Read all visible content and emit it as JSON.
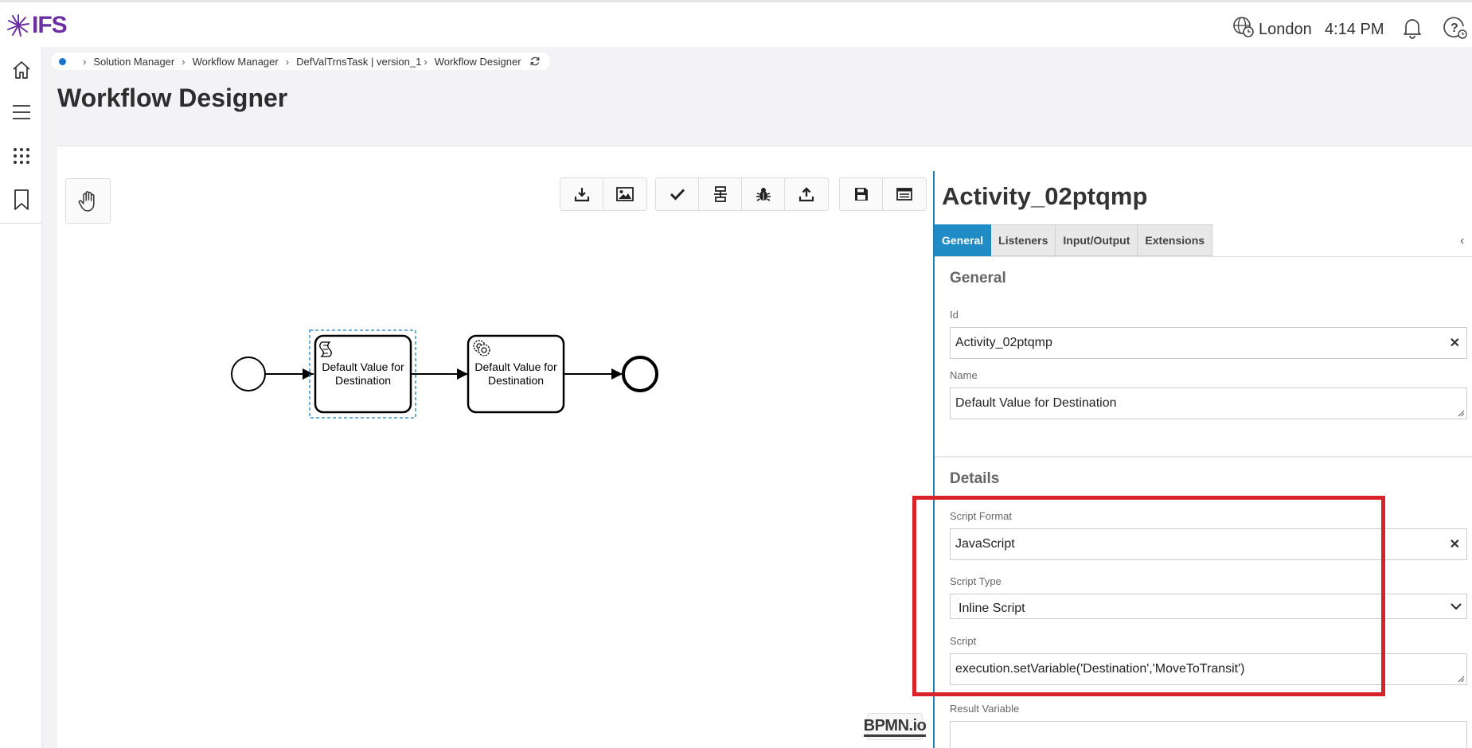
{
  "header": {
    "logo_text": "IFS",
    "location": "London",
    "time": "4:14 PM"
  },
  "breadcrumb": {
    "items": [
      "Solution Manager",
      "Workflow Manager",
      "DefValTrnsTask | version_1",
      "Workflow Designer"
    ]
  },
  "page": {
    "title": "Workflow Designer"
  },
  "diagram": {
    "task1_label": [
      "Default Value for",
      "Destination"
    ],
    "task2_label": [
      "Default Value for",
      "Destination"
    ]
  },
  "bpmn_logo": "BPMN.io",
  "panel": {
    "title": "Activity_02ptqmp",
    "tabs": [
      "General",
      "Listeners",
      "Input/Output",
      "Extensions"
    ],
    "general": {
      "heading": "General",
      "id_label": "Id",
      "id_value": "Activity_02ptqmp",
      "name_label": "Name",
      "name_value": "Default Value for Destination"
    },
    "details": {
      "heading": "Details",
      "script_format_label": "Script Format",
      "script_format_value": "JavaScript",
      "script_type_label": "Script Type",
      "script_type_value": "Inline Script",
      "script_label": "Script",
      "script_value": "execution.setVariable('Destination','MoveToTransit')",
      "result_variable_label": "Result Variable",
      "result_variable_value": ""
    }
  },
  "colors": {
    "accent": "#1f8cc6",
    "brand": "#6b2fa3",
    "highlight": "#d9232a"
  }
}
